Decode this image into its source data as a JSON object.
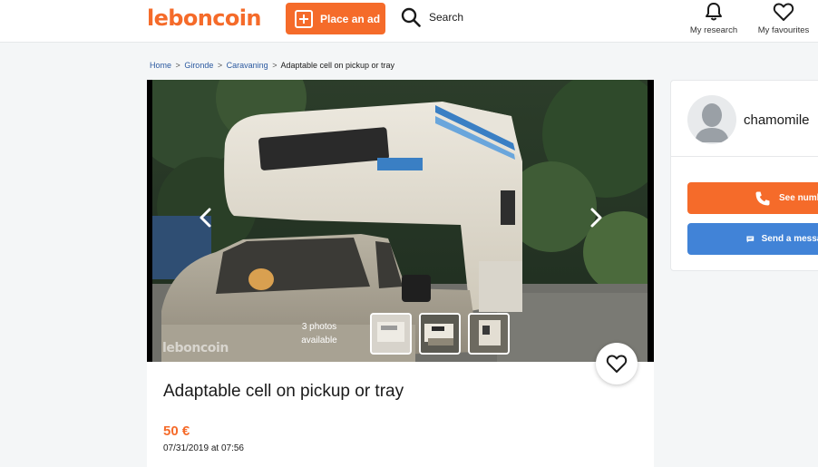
{
  "header": {
    "logo": "leboncoin",
    "place_ad": "Place an ad",
    "search": "Search",
    "my_research": "My research",
    "my_favourites": "My favourites"
  },
  "breadcrumb": {
    "home": "Home",
    "region": "Gironde",
    "category": "Caravaning",
    "current": "Adaptable cell on pickup or tray",
    "separator": ">"
  },
  "gallery": {
    "photo_count_line1": "3 photos",
    "photo_count_line2": "available",
    "watermark": "leboncoin"
  },
  "ad": {
    "title": "Adaptable cell on pickup or tray",
    "price": "50 €",
    "date": "07/31/2019 at 07:56"
  },
  "seller": {
    "name": "chamomile",
    "see_number": "See number",
    "send_message": "Send a message"
  },
  "colors": {
    "brand": "#f56b2a",
    "message_button": "#4183d7",
    "link": "#2c5aa0"
  },
  "icons": [
    "plus-icon",
    "search-icon",
    "bell-icon",
    "heart-icon",
    "chevron-left-icon",
    "chevron-right-icon",
    "phone-icon",
    "message-icon",
    "avatar-placeholder-icon"
  ]
}
